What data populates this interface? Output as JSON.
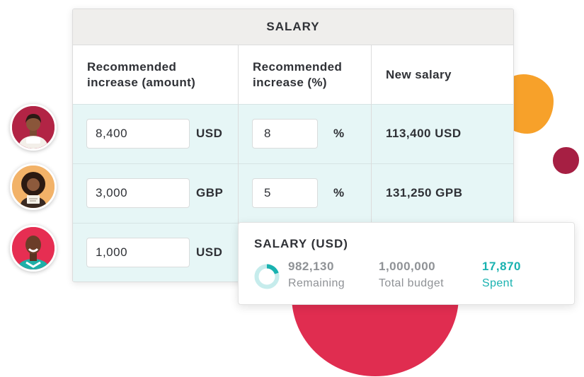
{
  "table": {
    "title": "SALARY",
    "columns": {
      "amount_line1": "Recommended",
      "amount_line2": "increase (amount)",
      "percent_line1": "Recommended",
      "percent_line2": "increase (%)",
      "new_salary": "New salary"
    },
    "rows": [
      {
        "amount": "8,400",
        "currency": "USD",
        "percent": "8",
        "percent_sign": "%",
        "new_salary": "113,400 USD"
      },
      {
        "amount": "3,000",
        "currency": "GBP",
        "percent": "5",
        "percent_sign": "%",
        "new_salary": "131,250 GPB"
      },
      {
        "amount": "1,000",
        "currency": "USD"
      }
    ]
  },
  "summary": {
    "title": "SALARY (USD)",
    "remaining_value": "982,130",
    "remaining_label": "Remaining",
    "total_value": "1,000,000",
    "total_label": "Total budget",
    "spent_value": "17,870",
    "spent_label": "Spent",
    "spent_fraction": 0.2
  },
  "colors": {
    "accent_teal": "#19b2b0",
    "row_background": "#e6f6f6",
    "blob_orange": "#f7a12a",
    "blob_maroon": "#a61f43",
    "blob_red": "#e02d50"
  }
}
